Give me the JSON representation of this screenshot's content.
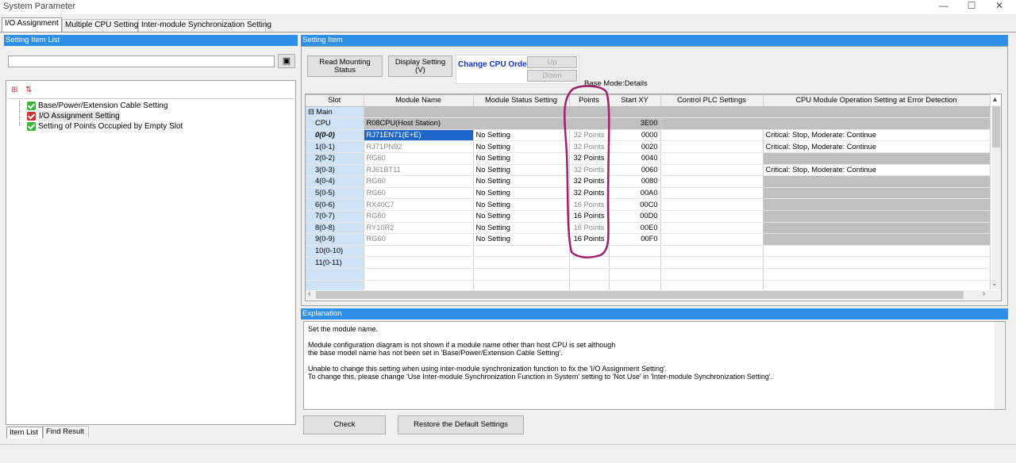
{
  "window": {
    "title": "System Parameter",
    "buttons": [
      "—",
      "☐",
      "✕"
    ]
  },
  "tabs": [
    {
      "label": "I/O Assignment",
      "active": true
    },
    {
      "label": "Multiple CPU Setting",
      "active": false
    },
    {
      "label": "Inter-module Synchronization Setting",
      "active": false
    }
  ],
  "left_panel": {
    "header": "Setting Item List",
    "search_placeholder": "",
    "tree": [
      {
        "label": "Base/Power/Extension Cable Setting",
        "selected": false
      },
      {
        "label": "I/O Assignment Setting",
        "selected": true
      },
      {
        "label": "Setting of Points Occupied by Empty Slot",
        "selected": false
      }
    ],
    "bottom_tabs": [
      "Item List",
      "Find Result"
    ]
  },
  "right_panel": {
    "header": "Setting Item",
    "buttons": {
      "read_mounting": "Read Mounting\nStatus",
      "display_setting": "Display Setting\n(V)",
      "change_cpu_order": "Change CPU Order",
      "up": "Up",
      "down": "Down"
    },
    "base_mode": "Base Mode:Details",
    "columns": [
      "Slot",
      "Module Name",
      "Module Status Setting",
      "Points",
      "Start XY",
      "Control PLC Settings",
      "CPU Module Operation Setting at Error Detection"
    ],
    "main_label": "Main",
    "cpu_row": {
      "slot": "CPU",
      "module": "R08CPU(Host Station)",
      "start": "3E00"
    },
    "rows": [
      {
        "slot": "0(0-0)",
        "module": "RJ71EN71(E+E)",
        "status": "No Setting",
        "points": "32 Points",
        "start": "0000",
        "error": "Critical: Stop, Moderate: Continue",
        "dim": true,
        "selected": true
      },
      {
        "slot": "1(0-1)",
        "module": "RJ71PN92",
        "status": "No Setting",
        "points": "32 Points",
        "start": "0020",
        "error": "Critical: Stop, Moderate: Continue",
        "dim": true
      },
      {
        "slot": "2(0-2)",
        "module": "RG60",
        "status": "No Setting",
        "points": "32 Points",
        "start": "0040",
        "error": "",
        "dim": false
      },
      {
        "slot": "3(0-3)",
        "module": "RJ61BT11",
        "status": "No Setting",
        "points": "32 Points",
        "start": "0060",
        "error": "Critical: Stop, Moderate: Continue",
        "dim": true
      },
      {
        "slot": "4(0-4)",
        "module": "RG60",
        "status": "No Setting",
        "points": "32 Points",
        "start": "0080",
        "error": "",
        "dim": false
      },
      {
        "slot": "5(0-5)",
        "module": "RG60",
        "status": "No Setting",
        "points": "32 Points",
        "start": "00A0",
        "error": "",
        "dim": false
      },
      {
        "slot": "6(0-6)",
        "module": "RX40C7",
        "status": "No Setting",
        "points": "16 Points",
        "start": "00C0",
        "error": "",
        "dim": true
      },
      {
        "slot": "7(0-7)",
        "module": "RG60",
        "status": "No Setting",
        "points": "16 Points",
        "start": "00D0",
        "error": "",
        "dim": false
      },
      {
        "slot": "8(0-8)",
        "module": "RY10R2",
        "status": "No Setting",
        "points": "16 Points",
        "start": "00E0",
        "error": "",
        "dim": true
      },
      {
        "slot": "9(0-9)",
        "module": "RG60",
        "status": "No Setting",
        "points": "16 Points",
        "start": "00F0",
        "error": "",
        "dim": false
      },
      {
        "slot": "10(0-10)"
      },
      {
        "slot": "11(0-11)"
      }
    ]
  },
  "explanation": {
    "header": "Explanation",
    "text": "Set the module name.\n\nModule configuration diagram is not shown if a module name other than host CPU is set although\nthe base model name has not been set in 'Base/Power/Extension Cable Setting'.\n\nUnable to change this setting when using inter-module synchronization function to fix the 'I/O Assignment Setting'.\nTo change this, please change 'Use Inter-module Synchronization Function in System' setting to 'Not Use' in 'Inter-module Synchronization Setting'."
  },
  "footer_buttons": {
    "check": "Check",
    "restore": "Restore the Default Settings"
  },
  "colors": {
    "accent": "#2e8fe6",
    "annotation": "#a0206e"
  }
}
